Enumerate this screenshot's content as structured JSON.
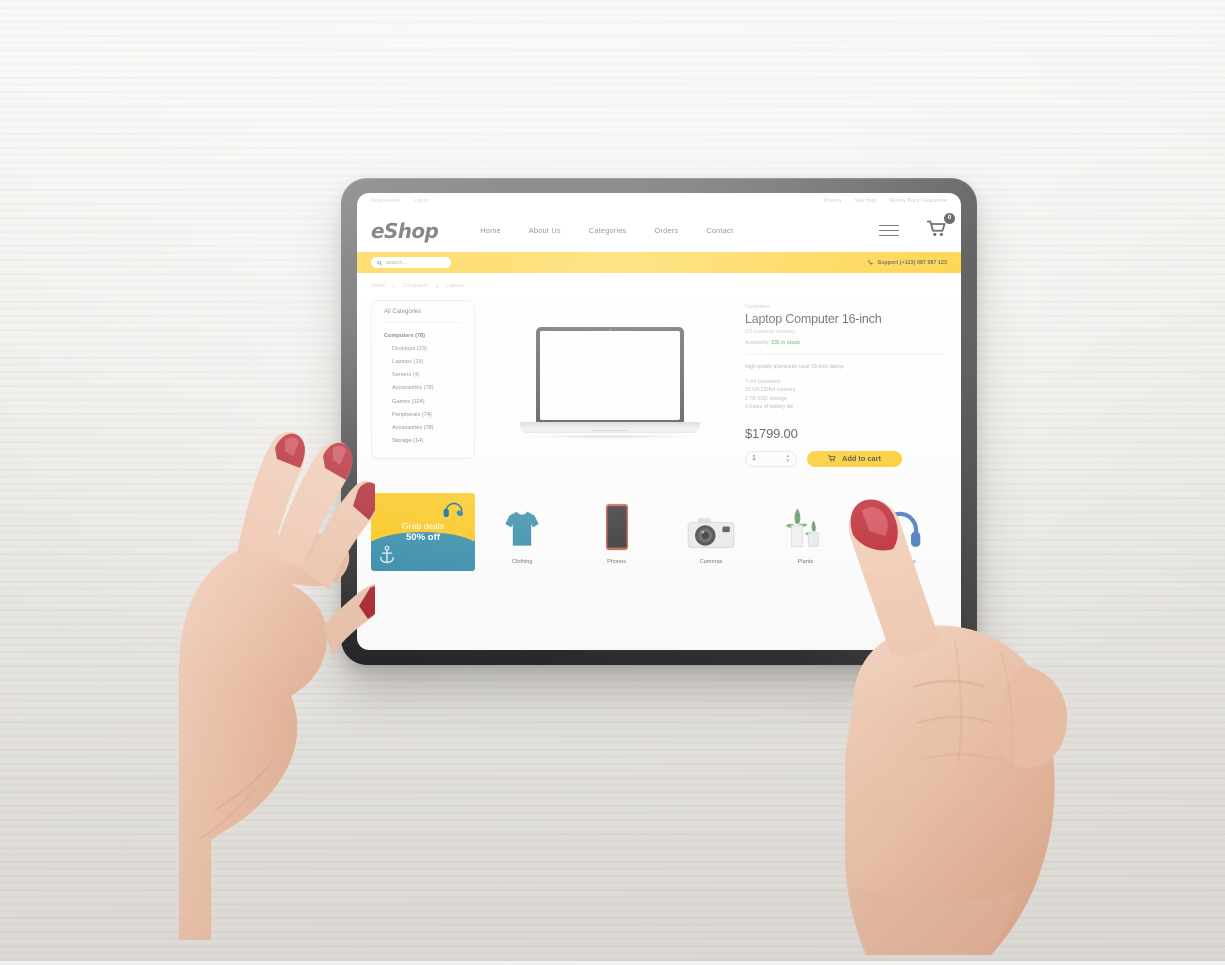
{
  "site": {
    "utility_left": [
      {
        "label": "Registration"
      },
      {
        "label": "Log-in"
      }
    ],
    "utility_right": [
      {
        "label": "Privacy"
      },
      {
        "label": "Site map"
      },
      {
        "label": "Money Back Guarantee"
      }
    ],
    "logo": "eShop",
    "nav": [
      {
        "label": "Home"
      },
      {
        "label": "About Us"
      },
      {
        "label": "Categories"
      },
      {
        "label": "Orders"
      },
      {
        "label": "Contact"
      }
    ],
    "cart_count": "0",
    "search": {
      "placeholder": "search...",
      "value": "",
      "icon": "search-icon"
    },
    "support": {
      "icon": "phone-icon",
      "text": "Support (+123) 987 987 123"
    },
    "accent_color": "#FDC300",
    "teal_color": "#1B7EA0",
    "stock_color": "#39A845"
  },
  "breadcrumb": [
    {
      "label": "Home"
    },
    {
      "label": "Computers"
    },
    {
      "label": "Laptops"
    }
  ],
  "sidebar": {
    "title": "All Categories",
    "items": [
      {
        "label": "Computers (78)",
        "level": 1
      },
      {
        "label": "Desktops (23)",
        "level": 2
      },
      {
        "label": "Laptops (19)",
        "level": 2
      },
      {
        "label": "Servers (4)",
        "level": 2
      },
      {
        "label": "Accessories (78)",
        "level": 2
      },
      {
        "label": "Games (124)",
        "level": 2
      },
      {
        "label": "Peripherals (74)",
        "level": 2
      },
      {
        "label": "Accessories (78)",
        "level": 2
      },
      {
        "label": "Storage (14)",
        "level": 2
      }
    ]
  },
  "product": {
    "category": "Computers",
    "title": "Laptop Computer 16-inch",
    "reviews": "(23 customer reviews)",
    "availability_label": "Availability:",
    "availability_value": "235 in stock",
    "description": "High quality aluminium case 16-inch laptop",
    "specs": [
      "7 nm processor",
      "32 GB DDR4 memory",
      "1 TB SSD storage",
      "6 hours of battery life"
    ],
    "price": "$1799.00",
    "quantity": "1",
    "add_to_cart_label": "Add to cart",
    "add_to_cart_icon": "cart-icon",
    "image_alt": "laptop-product-image"
  },
  "promo": {
    "line1": "Grab deals",
    "line2": "50% off"
  },
  "category_tiles": [
    {
      "label": "Clothing",
      "icon": "tshirt-icon"
    },
    {
      "label": "Phones",
      "icon": "smartphone-icon"
    },
    {
      "label": "Cameras",
      "icon": "camera-icon"
    },
    {
      "label": "Plants",
      "icon": "plant-icon"
    },
    {
      "label": "Headphones",
      "icon": "headphones-icon"
    }
  ]
}
